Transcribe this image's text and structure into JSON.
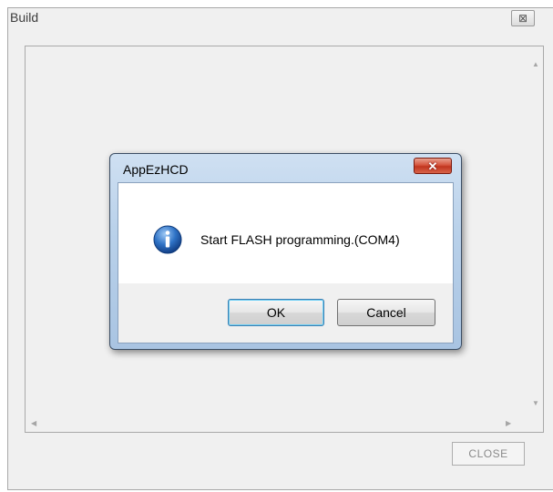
{
  "build_window": {
    "title": "Build",
    "close_icon_glyph": "⊠",
    "close_button_label": "CLOSE",
    "log_text": ""
  },
  "dialog": {
    "title": "AppEzHCD",
    "close_glyph": "✕",
    "message": "Start FLASH programming.(COM4)",
    "icon": "info-icon",
    "ok_label": "OK",
    "cancel_label": "Cancel"
  },
  "colors": {
    "dialog_frame": "#b9d1ea",
    "dialog_close": "#c1361f",
    "info_icon": "#1f5fae"
  }
}
